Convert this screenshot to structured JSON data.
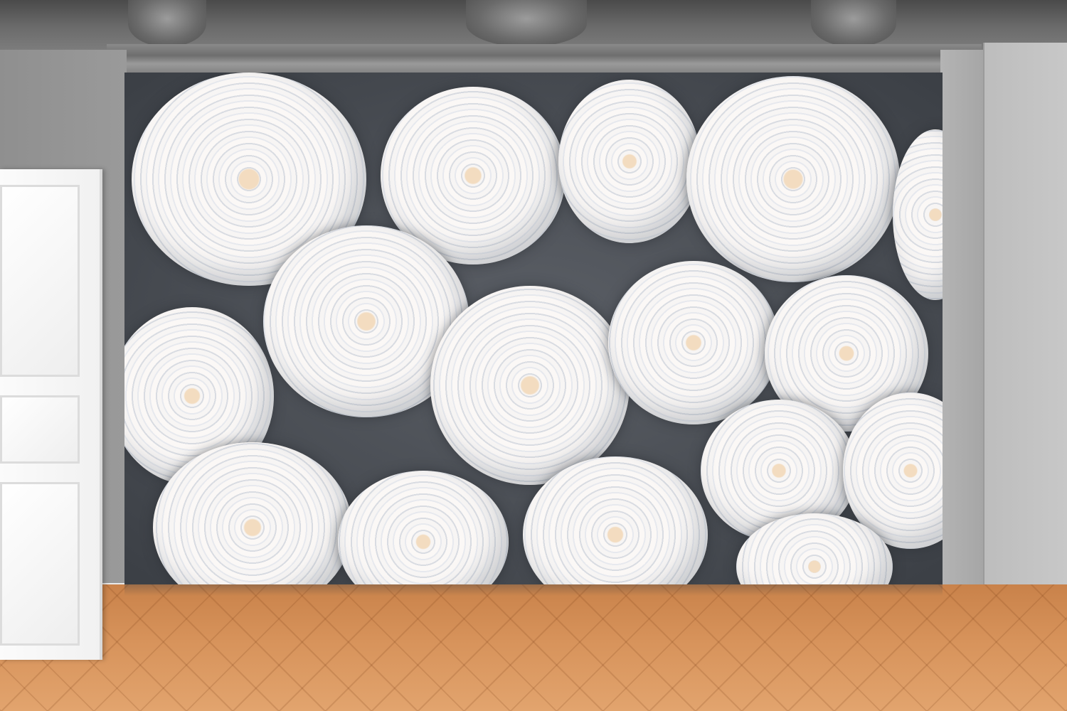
{
  "scene": {
    "subject": "white-roses-wall-mural",
    "colors": {
      "rose_petal": "#f7f5f4",
      "rose_shadow": "#d9dce2",
      "rose_center": "#f3dcc0",
      "wall_gray": "#9a9a9a",
      "floor_wood": "#d7935b",
      "door_white": "#f6f6f6"
    }
  }
}
